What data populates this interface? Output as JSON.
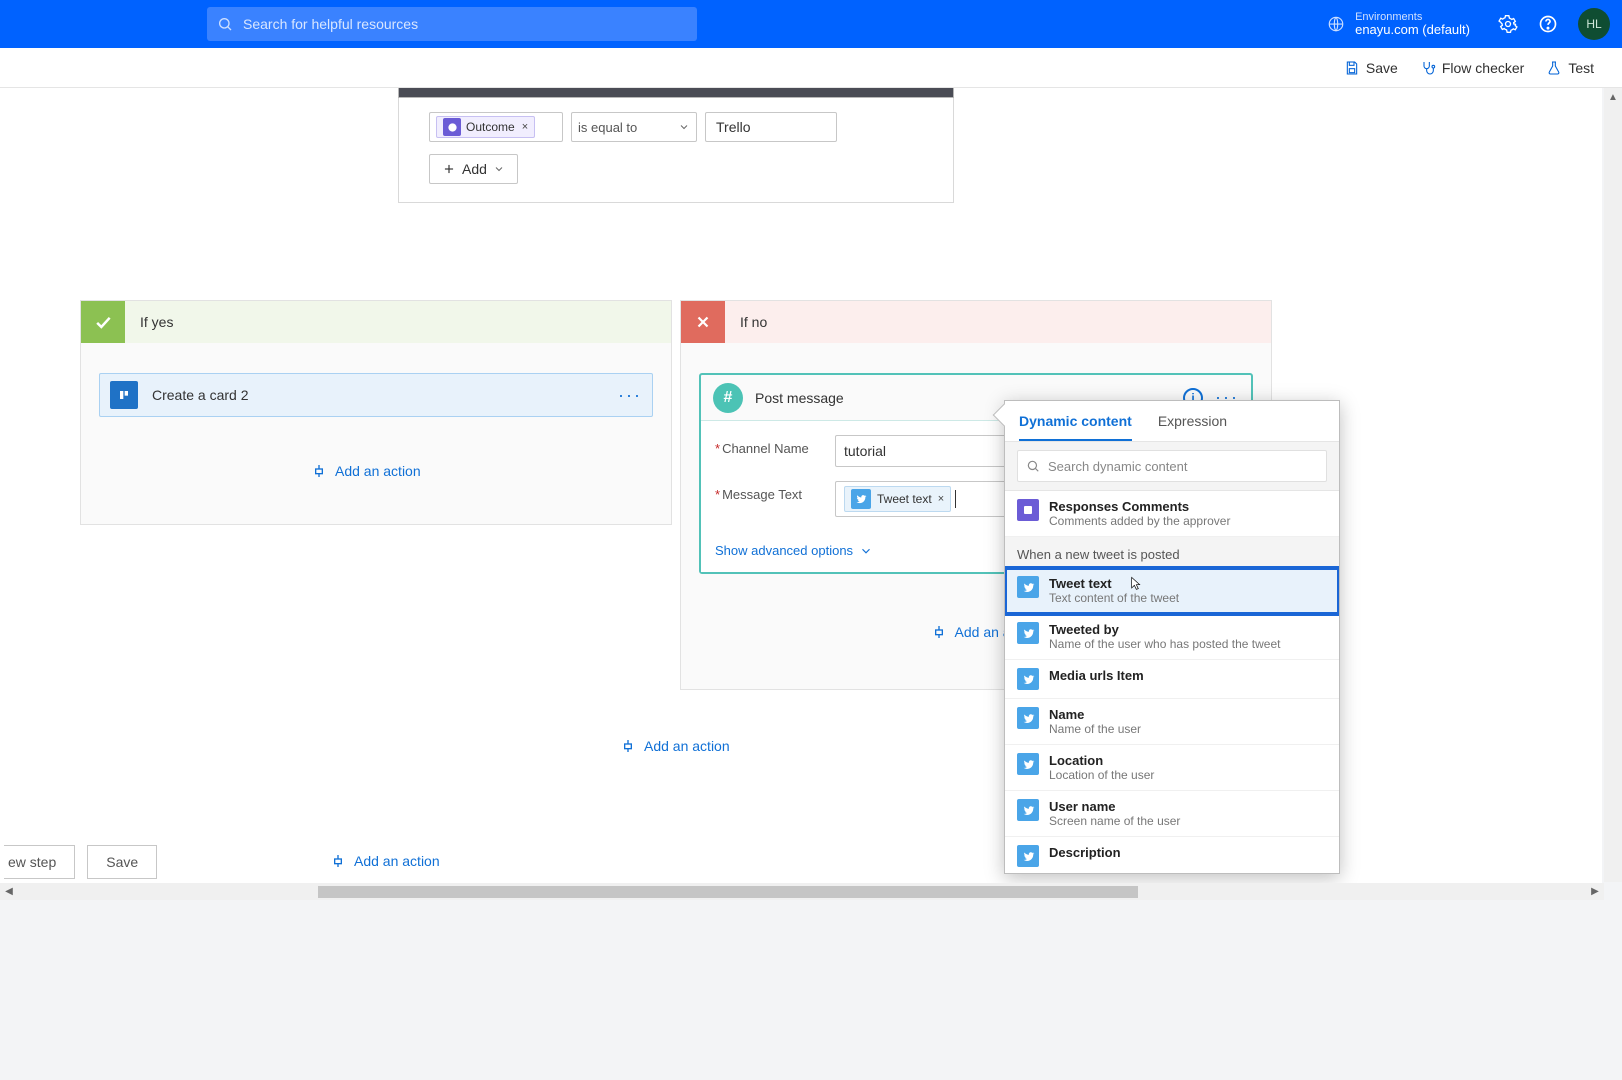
{
  "header": {
    "search_placeholder": "Search for helpful resources",
    "env_label": "Environments",
    "env_value": "enayu.com (default)",
    "avatar": "HL"
  },
  "toolbar": {
    "save": "Save",
    "flow_checker": "Flow checker",
    "test": "Test"
  },
  "condition": {
    "token_label": "Outcome",
    "operator": "is equal to",
    "value": "Trello",
    "add_label": "Add"
  },
  "branches": {
    "yes": {
      "title": "If yes",
      "step_title": "Create a card 2",
      "add_action": "Add an action"
    },
    "no": {
      "title": "If no",
      "step_title": "Post message",
      "channel_label": "Channel Name",
      "channel_value": "tutorial",
      "msg_label": "Message Text",
      "msg_token": "Tweet text",
      "advanced": "Show advanced options",
      "add_action": "Add an act"
    }
  },
  "between_add": "Add an action",
  "final_add": "Add an action",
  "dc": {
    "tab1": "Dynamic content",
    "tab2": "Expression",
    "search_placeholder": "Search dynamic content",
    "approval_item_t": "Responses Comments",
    "approval_item_d": "Comments added by the approver",
    "group_tw": "When a new tweet is posted",
    "items": [
      {
        "t": "Tweet text",
        "d": "Text content of the tweet"
      },
      {
        "t": "Tweeted by",
        "d": "Name of the user who has posted the tweet"
      },
      {
        "t": "Media urls Item",
        "d": ""
      },
      {
        "t": "Name",
        "d": "Name of the user"
      },
      {
        "t": "Location",
        "d": "Location of the user"
      },
      {
        "t": "User name",
        "d": "Screen name of the user"
      },
      {
        "t": "Description",
        "d": ""
      }
    ]
  },
  "bottom": {
    "new_step": "ew step",
    "save": "Save"
  }
}
